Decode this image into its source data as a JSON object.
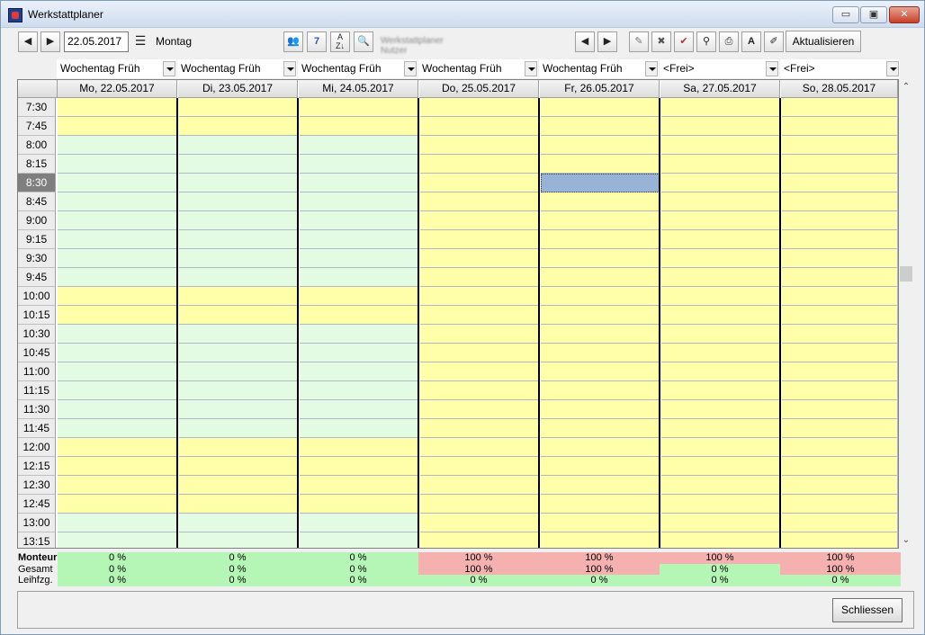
{
  "window": {
    "title": "Werkstattplaner",
    "minimize": "▭",
    "maximize": "▣",
    "close": "✕"
  },
  "toolbar": {
    "date_value": "22.05.2017",
    "weekday": "Montag",
    "blurred_text": "Werkstattplaner Nutzer",
    "refresh_label": "Aktualisieren"
  },
  "shifts": [
    "Wochentag Früh",
    "Wochentag Früh",
    "Wochentag Früh",
    "Wochentag Früh",
    "Wochentag Früh",
    "<Frei>",
    "<Frei>"
  ],
  "days": [
    "Mo, 22.05.2017",
    "Di, 23.05.2017",
    "Mi, 24.05.2017",
    "Do, 25.05.2017",
    "Fr, 26.05.2017",
    "Sa, 27.05.2017",
    "So, 28.05.2017"
  ],
  "times": [
    "7:30",
    "7:45",
    "8:00",
    "8:15",
    "8:30",
    "8:45",
    "9:00",
    "9:15",
    "9:30",
    "9:45",
    "10:00",
    "10:15",
    "10:30",
    "10:45",
    "11:00",
    "11:15",
    "11:30",
    "11:45",
    "12:00",
    "12:15",
    "12:30",
    "12:45",
    "13:00",
    "13:15"
  ],
  "current_time": "8:30",
  "selected_slot": {
    "day": "Fr, 26.05.2017",
    "time": "8:30"
  },
  "colors": {
    "open": "#e2fbe2",
    "blocked": "#ffffaa",
    "selected": "#99b3d6",
    "util_ok": "#b5f5b5",
    "util_full": "#f5b0b0"
  },
  "utilization": {
    "labels": [
      "Monteur",
      "Gesamt",
      "Leihfzg."
    ],
    "monteur": [
      "0 %",
      "0 %",
      "0 %",
      "100 %",
      "100 %",
      "100 %",
      "100 %"
    ],
    "gesamt": [
      "0 %",
      "0 %",
      "0 %",
      "100 %",
      "100 %",
      "0 %",
      "100 %"
    ],
    "leihfzg": [
      "0 %",
      "0 %",
      "0 %",
      "0 %",
      "0 %",
      "0 %",
      "0 %"
    ]
  },
  "footer": {
    "close_label": "Schliessen"
  }
}
